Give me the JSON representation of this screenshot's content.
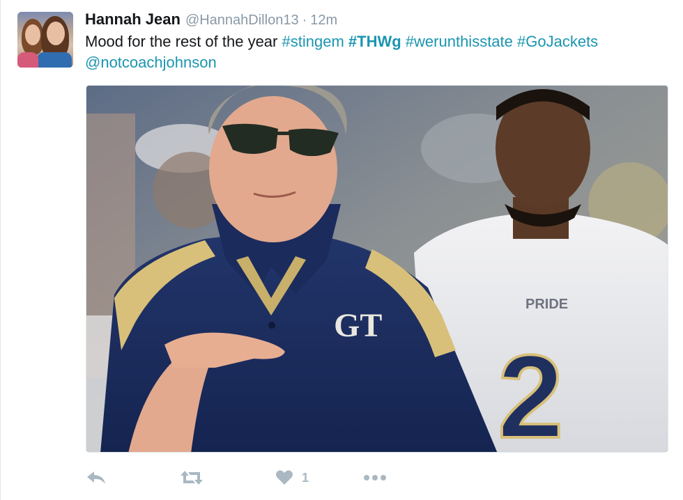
{
  "tweet": {
    "author": {
      "name": "Hannah Jean",
      "handle": "@HannahDillon13",
      "separator": "·",
      "time": "12m"
    },
    "body": {
      "text": "Mood for the rest of the year",
      "hashtags": [
        "#stingem",
        "#THWg",
        "#werunthisstate",
        "#GoJackets"
      ],
      "mention": "@notcoachjohnson"
    },
    "media": {
      "logo_text": "GT",
      "jersey_text": "PRIDE",
      "jersey_number": "2"
    },
    "actions": {
      "like_count": "1"
    }
  },
  "colors": {
    "link": "#1b95b0",
    "secondary_text": "#8899a6",
    "action_icon": "#aab8c2",
    "navy": "#1f2f5e",
    "gold": "#d8c07a"
  },
  "icons": [
    "reply-icon",
    "retweet-icon",
    "heart-icon",
    "more-icon"
  ]
}
